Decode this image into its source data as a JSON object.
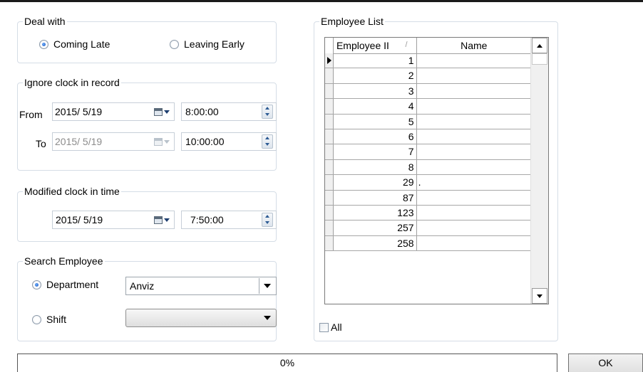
{
  "deal_with": {
    "legend": "Deal with",
    "options": [
      {
        "label": "Coming Late",
        "selected": true
      },
      {
        "label": "Leaving Early",
        "selected": false
      }
    ]
  },
  "ignore_record": {
    "legend": "Ignore clock in record",
    "from_label": "From",
    "to_label": "To",
    "from_date": "2015/  5/19",
    "from_time": "8:00:00",
    "to_date": "2015/  5/19",
    "to_time": "10:00:00"
  },
  "modified_time": {
    "legend": "Modified clock in time",
    "date": "2015/  5/19",
    "time": "7:50:00"
  },
  "search_employee": {
    "legend": "Search Employee",
    "department_label": "Department",
    "department_selected": true,
    "department_value": "Anviz",
    "shift_label": "Shift",
    "shift_selected": false,
    "shift_value": ""
  },
  "employee_list": {
    "legend": "Employee List",
    "columns": [
      "Employee II",
      "Name"
    ],
    "sort_glyph": "/",
    "rows": [
      {
        "id": "1",
        "name": ""
      },
      {
        "id": "2",
        "name": ""
      },
      {
        "id": "3",
        "name": ""
      },
      {
        "id": "4",
        "name": ""
      },
      {
        "id": "5",
        "name": ""
      },
      {
        "id": "6",
        "name": ""
      },
      {
        "id": "7",
        "name": ""
      },
      {
        "id": "8",
        "name": ""
      },
      {
        "id": "29",
        "name": "."
      },
      {
        "id": "87",
        "name": ""
      },
      {
        "id": "123",
        "name": ""
      },
      {
        "id": "257",
        "name": ""
      },
      {
        "id": "258",
        "name": ""
      }
    ],
    "all_label": "All",
    "all_checked": false
  },
  "progress": {
    "text": "0%",
    "value": 0
  },
  "ok_button": "OK"
}
